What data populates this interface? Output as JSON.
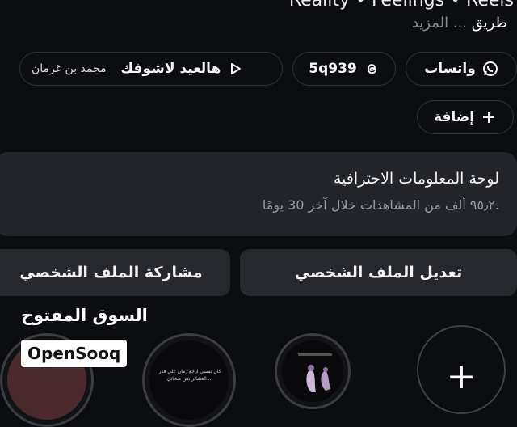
{
  "profile": {
    "categories": "Reality • Feelings • Reels",
    "bio_first": "طريق",
    "bio_more": " ... المزيد"
  },
  "links": {
    "whatsapp": "واتساب",
    "threads": "5q939",
    "reel_title": "هالعيد لاشوفك",
    "reel_author": "محمد بن غرمان",
    "add": "إضافة"
  },
  "dashboard": {
    "title": "لوحة المعلومات الاحترافية",
    "subtitle": "٩٥٫٢ ألف من المشاهدات خلال آخر 30 يومًا."
  },
  "actions": {
    "edit_profile": "تعديل الملف الشخصي",
    "share_profile": "مشاركة الملف الشخصي"
  },
  "highlights": {
    "new_label": "+",
    "story3_text": "كان نفسي ارجع زمان على قدر العشاير بس صحابي ..."
  },
  "watermark": {
    "arabic": "السوق المفتوح",
    "english": "OpenSooq"
  },
  "colors": {
    "background": "#0c0d11",
    "card": "#23252b",
    "button": "#26282e",
    "muted": "#9a9ba0"
  }
}
